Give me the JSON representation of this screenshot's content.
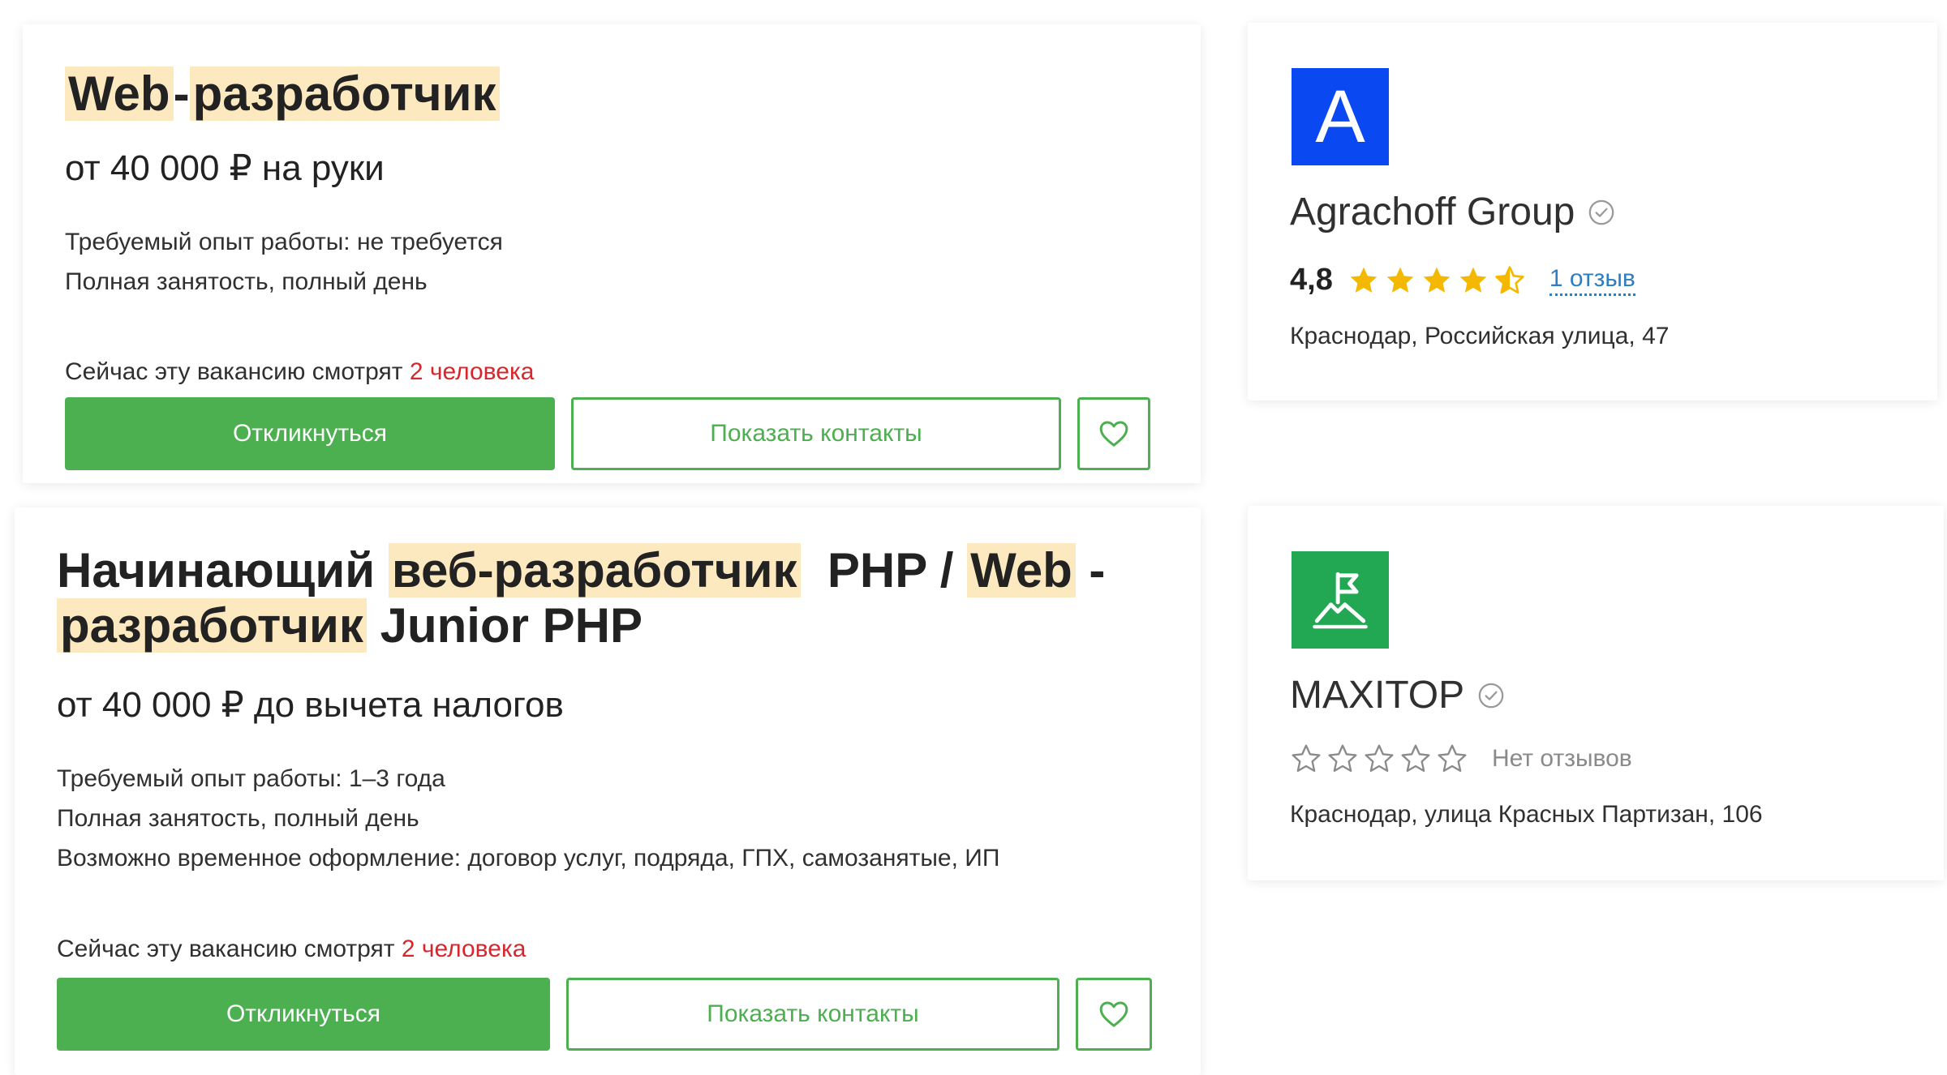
{
  "vacancies": [
    {
      "title_parts": [
        {
          "text": "Web",
          "highlight": true
        },
        {
          "text": "-",
          "highlight": false
        },
        {
          "text": "разработчик",
          "highlight": true
        }
      ],
      "salary": "от 40 000 ₽ на руки",
      "info_lines": [
        "Требуемый опыт работы: не требуется",
        "Полная занятость, полный день"
      ],
      "viewers_prefix": "Сейчас эту вакансию смотрят",
      "viewers_count": "2 человека",
      "respond_label": "Откликнуться",
      "contacts_label": "Показать контакты",
      "favorite_icon": "heart-icon"
    },
    {
      "title_parts": [
        {
          "text": "Начинающий ",
          "highlight": false
        },
        {
          "text": "веб-разработчик",
          "highlight": true
        },
        {
          "text": "  PHP / ",
          "highlight": false
        },
        {
          "text": "Web",
          "highlight": true
        },
        {
          "text": " -",
          "highlight": false
        },
        {
          "text": "разработчик",
          "highlight": true
        },
        {
          "text": " Junior PHP",
          "highlight": false
        }
      ],
      "salary": "от 40 000 ₽ до вычета налогов",
      "info_lines": [
        "Требуемый опыт работы: 1–3 года",
        "Полная занятость, полный день",
        "Возможно временное оформление: договор услуг, подряда, ГПХ, самозанятые, ИП"
      ],
      "viewers_prefix": "Сейчас эту вакансию смотрят",
      "viewers_count": "2 человека",
      "respond_label": "Откликнуться",
      "contacts_label": "Показать контакты",
      "favorite_icon": "heart-icon"
    }
  ],
  "companies": [
    {
      "logo_letter": "A",
      "logo_color": "#0a48f2",
      "name": "Agrachoff Group",
      "verified_icon": "verified-check-icon",
      "rating": "4,8",
      "stars": 4.5,
      "reviews": "1 отзыв",
      "address": "Краснодар, Российская улица, 47"
    },
    {
      "logo_icon": "flag-mountain-icon",
      "logo_color": "#22a852",
      "name": "MAXITOP",
      "verified_icon": "verified-check-icon",
      "stars": 0,
      "reviews": "Нет отзывов",
      "address": "Краснодар, улица Красных Партизан, 106"
    }
  ],
  "colors": {
    "accent_green": "#4caf50",
    "highlight": "#fde9c0",
    "viewers_red": "#d9262c",
    "star_gold": "#f5b800",
    "link_blue": "#2f7ec4"
  }
}
